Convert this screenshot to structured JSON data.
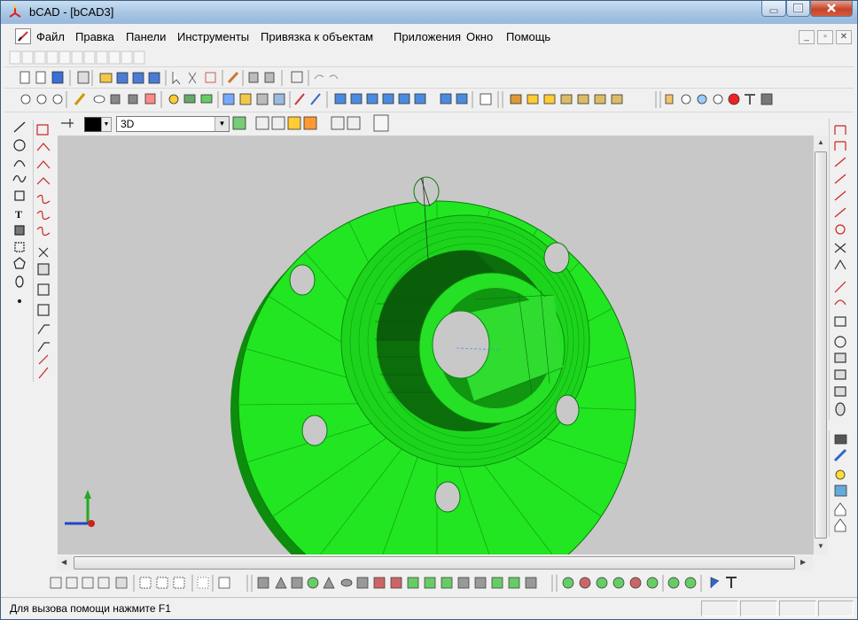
{
  "window": {
    "title": "bCAD - [bCAD3]",
    "controls": [
      "minimize-icon",
      "maximize-icon",
      "close-icon"
    ]
  },
  "menu": {
    "items": [
      "Файл",
      "Правка",
      "Панели",
      "Инструменты",
      "Привязка к объектам",
      "Приложения",
      "Окно",
      "Помощь"
    ],
    "mdi_controls": [
      "minimize-icon",
      "restore-icon",
      "close-icon"
    ]
  },
  "toolbar": {
    "layer_value": "3D",
    "current_color": "#000000"
  },
  "viewport": {
    "background": "#c8c8c8",
    "model_color": "#19e619",
    "view_mode": "3D"
  },
  "statusbar": {
    "text": "Для вызова помощи нажмите F1"
  },
  "colors": {
    "title_gradient": "#a9c6e4",
    "close_button": "#c6452a",
    "model_green": "#19e619",
    "model_dark_green": "#0f9a0f"
  }
}
